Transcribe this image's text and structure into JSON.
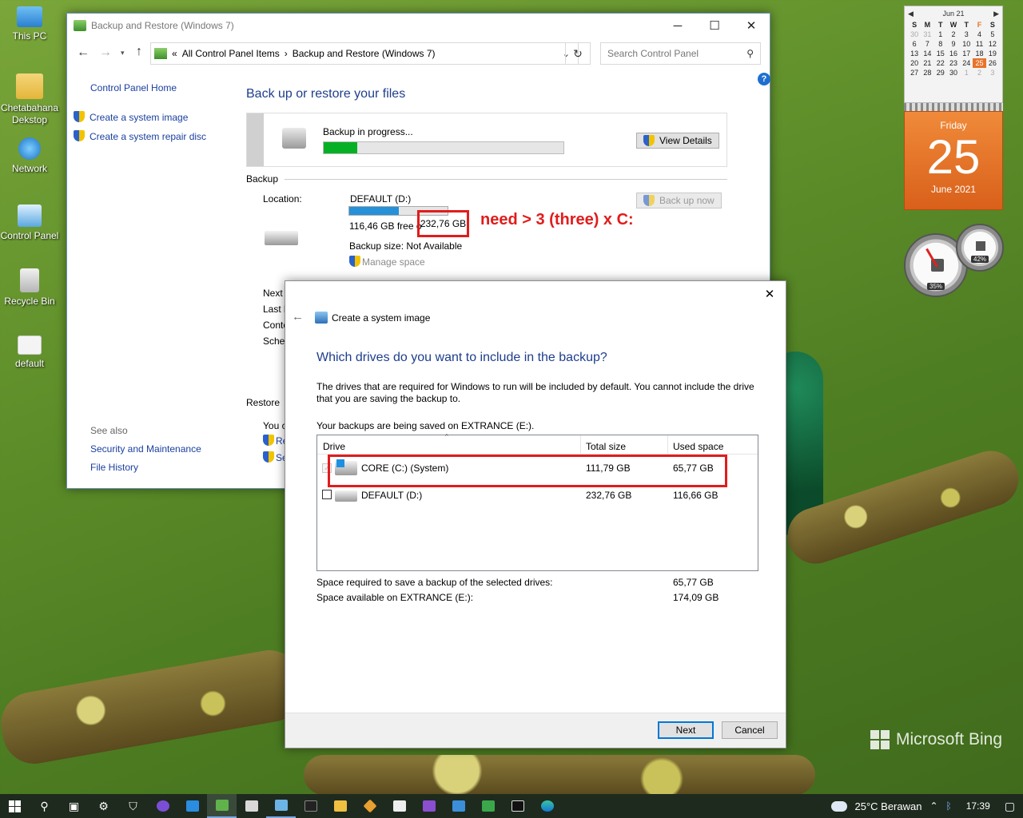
{
  "desktop": {
    "icons": [
      {
        "label": "This PC"
      },
      {
        "label": "Chetabahana Dekstop"
      },
      {
        "label": "Network"
      },
      {
        "label": "Control Panel"
      },
      {
        "label": "Recycle Bin"
      },
      {
        "label": "default"
      }
    ],
    "bing_label": "Microsoft Bing"
  },
  "main_window": {
    "title": "Backup and Restore (Windows 7)",
    "address": {
      "prefix": "«",
      "crumb1": "All Control Panel Items",
      "sep": "›",
      "crumb2": "Backup and Restore (Windows 7)"
    },
    "search_placeholder": "Search Control Panel",
    "sidebar": {
      "home": "Control Panel Home",
      "create_image": "Create a system image",
      "create_disc": "Create a system repair disc",
      "see_also": "See also",
      "security": "Security and Maintenance",
      "file_history": "File History"
    },
    "heading": "Back up or restore your files",
    "progress": {
      "label": "Backup in progress...",
      "fraction": 0.14,
      "view_details": "View Details"
    },
    "backup_section": "Backup",
    "location_label": "Location:",
    "location_name": "DEFAULT (D:)",
    "location_usage_fraction": 0.5,
    "free_text": "116,46 GB free o",
    "total_text": "232,76 GB",
    "backup_size": "Backup size: Not Available",
    "manage_space": "Manage space",
    "back_up_now": "Back up now",
    "partial_labels": [
      "Next",
      "Last b",
      "Conte",
      "Sched"
    ],
    "restore_section": "Restore",
    "restore_partial": [
      "You c",
      "Re",
      "Se"
    ],
    "annotation": "need > 3 (three) x C:"
  },
  "dialog": {
    "title": "Create a system image",
    "heading": "Which drives do you want to include in the backup?",
    "description": "The drives that are required for Windows to run will be included by default. You cannot include the drive that you are saving the backup to.",
    "saving_to": "Your backups are being saved on EXTRANCE (E:).",
    "columns": [
      "Drive",
      "Total size",
      "Used space"
    ],
    "rows": [
      {
        "name": "CORE (C:) (System)",
        "total": "111,79 GB",
        "used": "65,77 GB"
      },
      {
        "name": "DEFAULT (D:)",
        "total": "232,76 GB",
        "used": "116,66 GB"
      }
    ],
    "required_label": "Space required to save a backup of the selected drives:",
    "required_value": "65,77 GB",
    "available_label": "Space available on EXTRANCE (E:):",
    "available_value": "174,09 GB",
    "next": "Next",
    "cancel": "Cancel"
  },
  "calendar": {
    "month": "Jun 21",
    "days_header": [
      "S",
      "M",
      "T",
      "W",
      "T",
      "F",
      "S"
    ],
    "weeks": [
      [
        "30",
        "31",
        "1",
        "2",
        "3",
        "4",
        "5"
      ],
      [
        "6",
        "7",
        "8",
        "9",
        "10",
        "11",
        "12"
      ],
      [
        "13",
        "14",
        "15",
        "16",
        "17",
        "18",
        "19"
      ],
      [
        "20",
        "21",
        "22",
        "23",
        "24",
        "25",
        "26"
      ],
      [
        "27",
        "28",
        "29",
        "30",
        "1",
        "2",
        "3"
      ]
    ],
    "weekday": "Friday",
    "day": "25",
    "month_year": "June 2021"
  },
  "gauges": {
    "cpu": "35%",
    "mem": "42%"
  },
  "taskbar": {
    "weather": "25°C  Berawan",
    "time": "17:39"
  },
  "colors": {
    "accent_orange": "#e8732b",
    "annotation_red": "#e11c1c",
    "progress_green": "#06b025",
    "usage_blue": "#2690d9"
  }
}
